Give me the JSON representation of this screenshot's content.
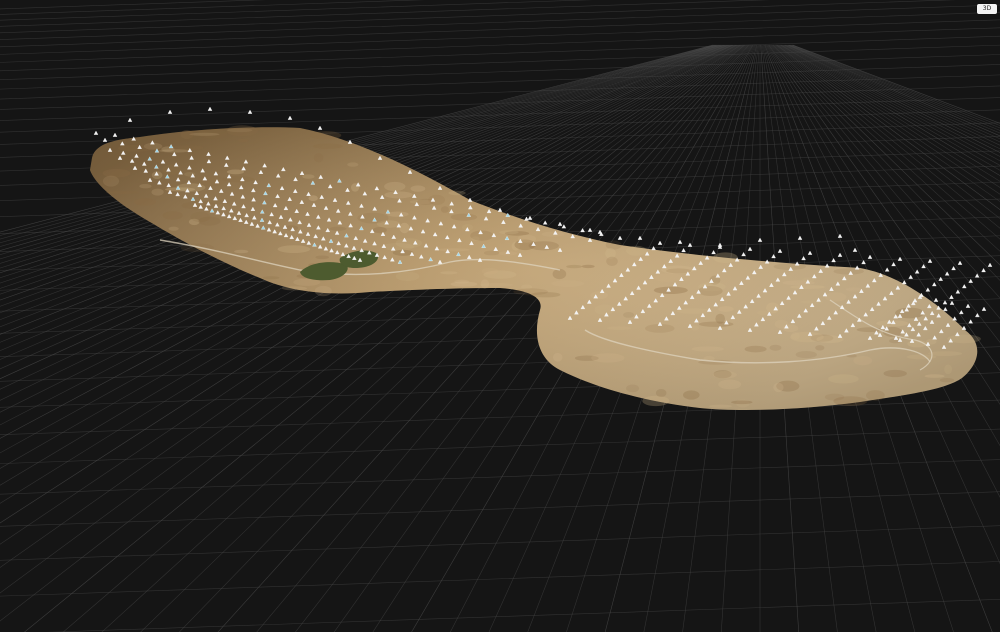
{
  "viewer": {
    "view_mode_label": "3D"
  },
  "colors": {
    "background": "#151515",
    "grid": "#4a4a4a",
    "grid_major": "#5c5c5c",
    "terrain_main": "#b89765",
    "terrain_dark": "#8a6c45",
    "terrain_light": "#d3b98e",
    "vegetation": "#4d5b2f",
    "road": "#ded3bd",
    "camera_marker": "#f2f2f2",
    "camera_marker_accent": "#9fd6e8",
    "button_bg": "#f4f4f4"
  },
  "icons": {
    "camera_marker": "camera-pyramid-icon"
  }
}
